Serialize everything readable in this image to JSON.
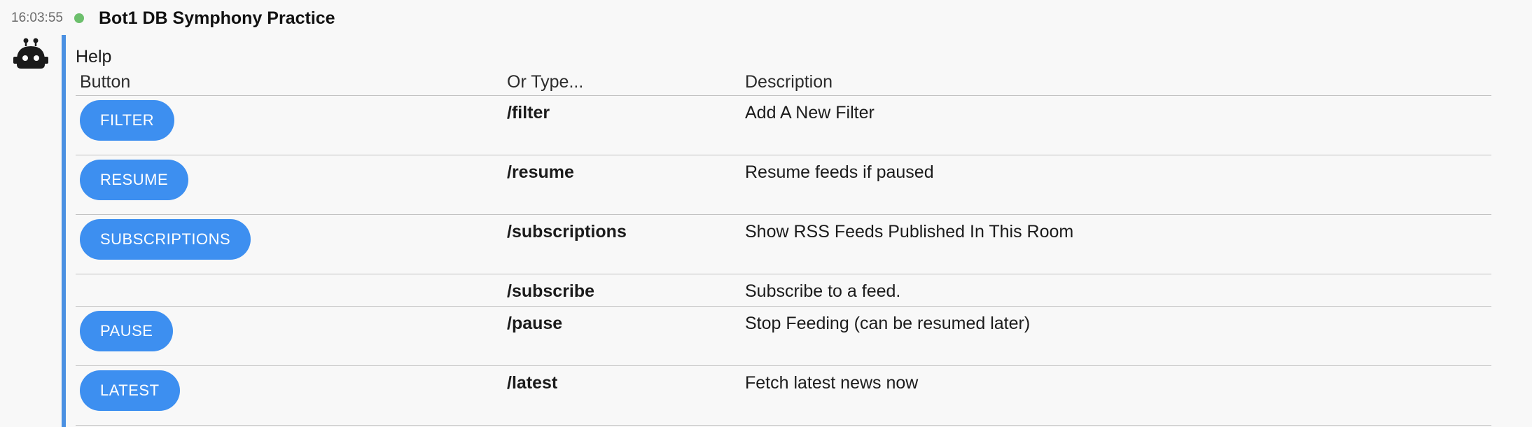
{
  "message": {
    "timestamp": "16:03:55",
    "sender": "Bot1 DB Symphony Practice",
    "presence_color": "#6cbf6c",
    "avatar_icon": "robot-icon",
    "accent_color": "#4a90e2"
  },
  "help": {
    "title": "Help",
    "columns": [
      "Button",
      "Or Type...",
      "Description"
    ],
    "button_color": "#3d8ff0",
    "rows": [
      {
        "button": "FILTER",
        "command": "/filter",
        "description": "Add A New Filter"
      },
      {
        "button": "RESUME",
        "command": "/resume",
        "description": "Resume feeds if paused"
      },
      {
        "button": "SUBSCRIPTIONS",
        "command": "/subscriptions",
        "description": "Show RSS Feeds Published In This Room"
      },
      {
        "button": "",
        "command": "/subscribe",
        "description": "Subscribe to a feed."
      },
      {
        "button": "PAUSE",
        "command": "/pause",
        "description": "Stop Feeding (can be resumed later)"
      },
      {
        "button": "LATEST",
        "command": "/latest",
        "description": "Fetch latest news now"
      }
    ]
  }
}
